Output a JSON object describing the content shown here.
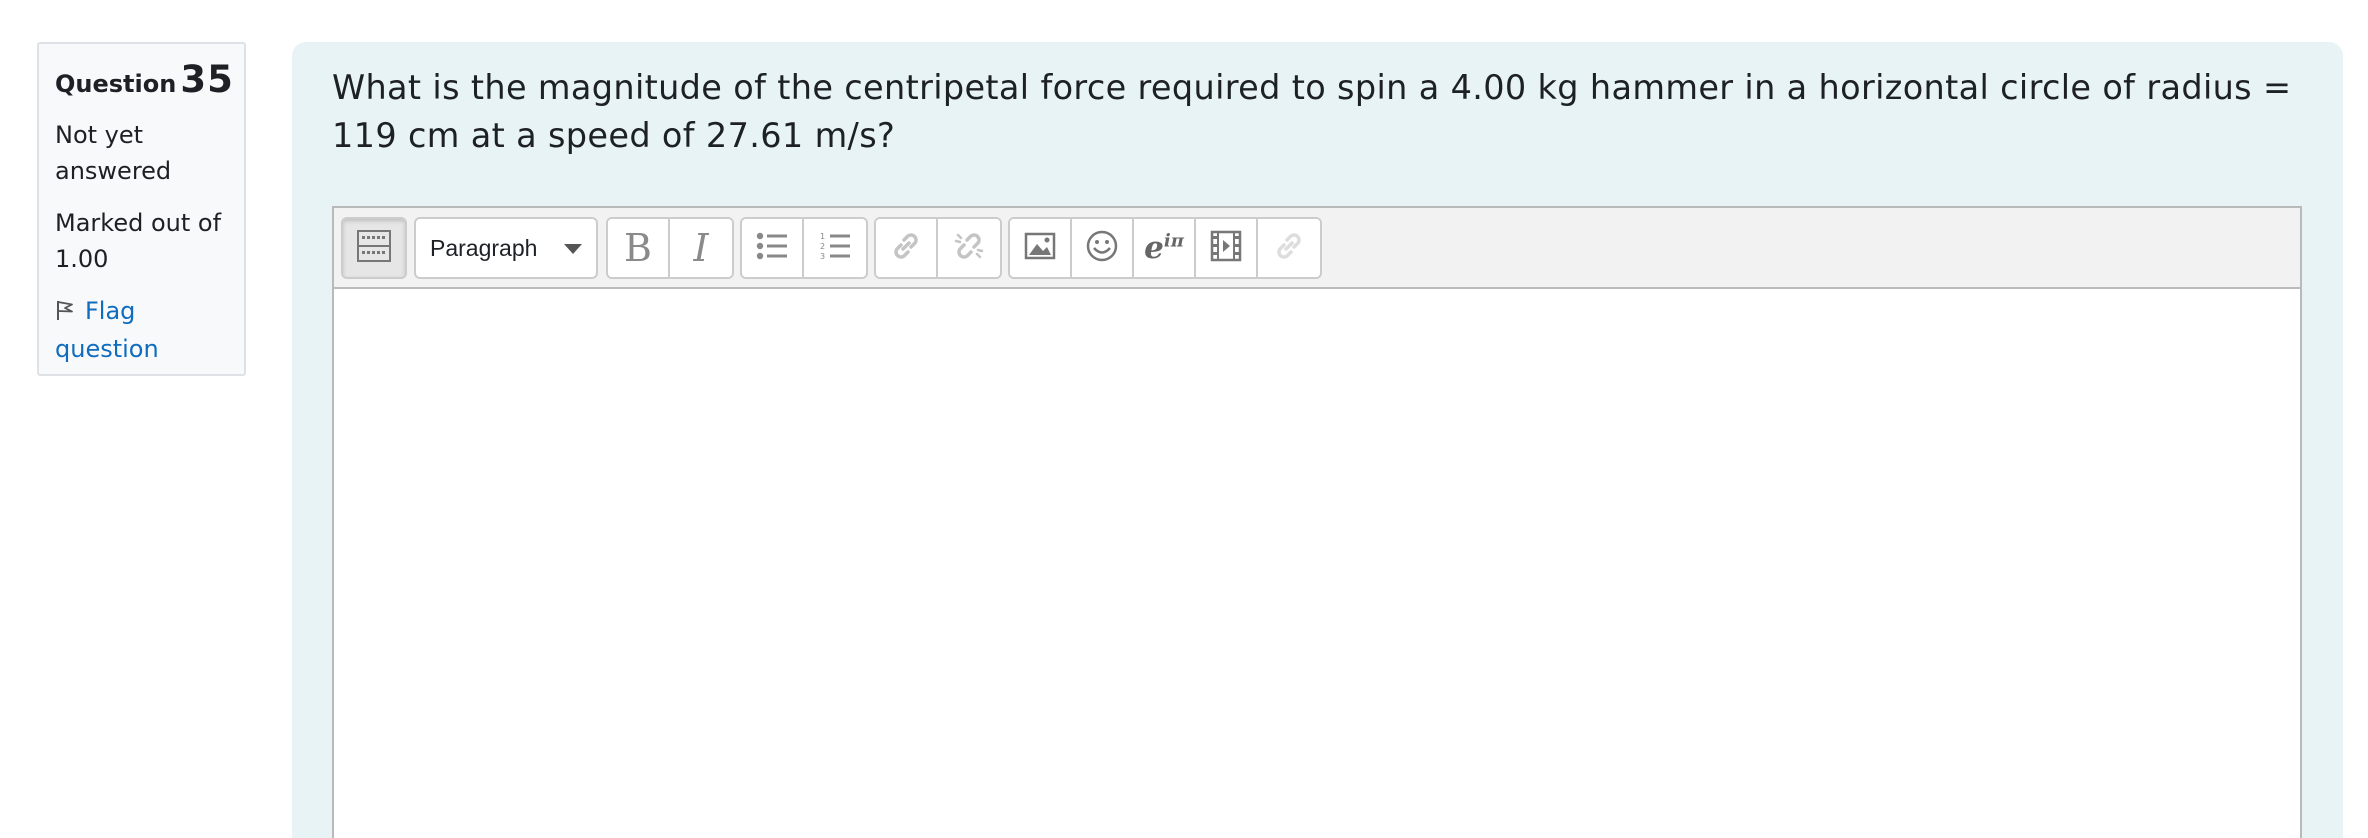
{
  "info": {
    "question_label": "Question",
    "question_number": "35",
    "state": "Not yet answered",
    "grade": "Marked out of 1.00",
    "flag_label": "Flag question"
  },
  "question": {
    "text": "What is the magnitude of the centripetal force required to spin a 4.00 kg hammer in a horizontal circle of radius = 119 cm at a speed of 27.61 m/s?"
  },
  "editor": {
    "block_format": "Paragraph",
    "toolbar_icons": [
      "toolbar-toggle-icon",
      "bold-icon",
      "italic-icon",
      "unordered-list-icon",
      "ordered-list-icon",
      "link-icon",
      "unlink-icon",
      "image-icon",
      "emoji-icon",
      "equation-icon",
      "media-icon",
      "manage-files-icon"
    ],
    "bold_glyph": "B",
    "italic_glyph": "I",
    "equation_glyph": "e",
    "equation_sup": "iπ",
    "content": ""
  },
  "colors": {
    "content_bg": "#e7f3f5",
    "link": "#0f6cbf",
    "info_bg": "#f8f9fa",
    "toolbar_bg": "#f2f2f2"
  }
}
